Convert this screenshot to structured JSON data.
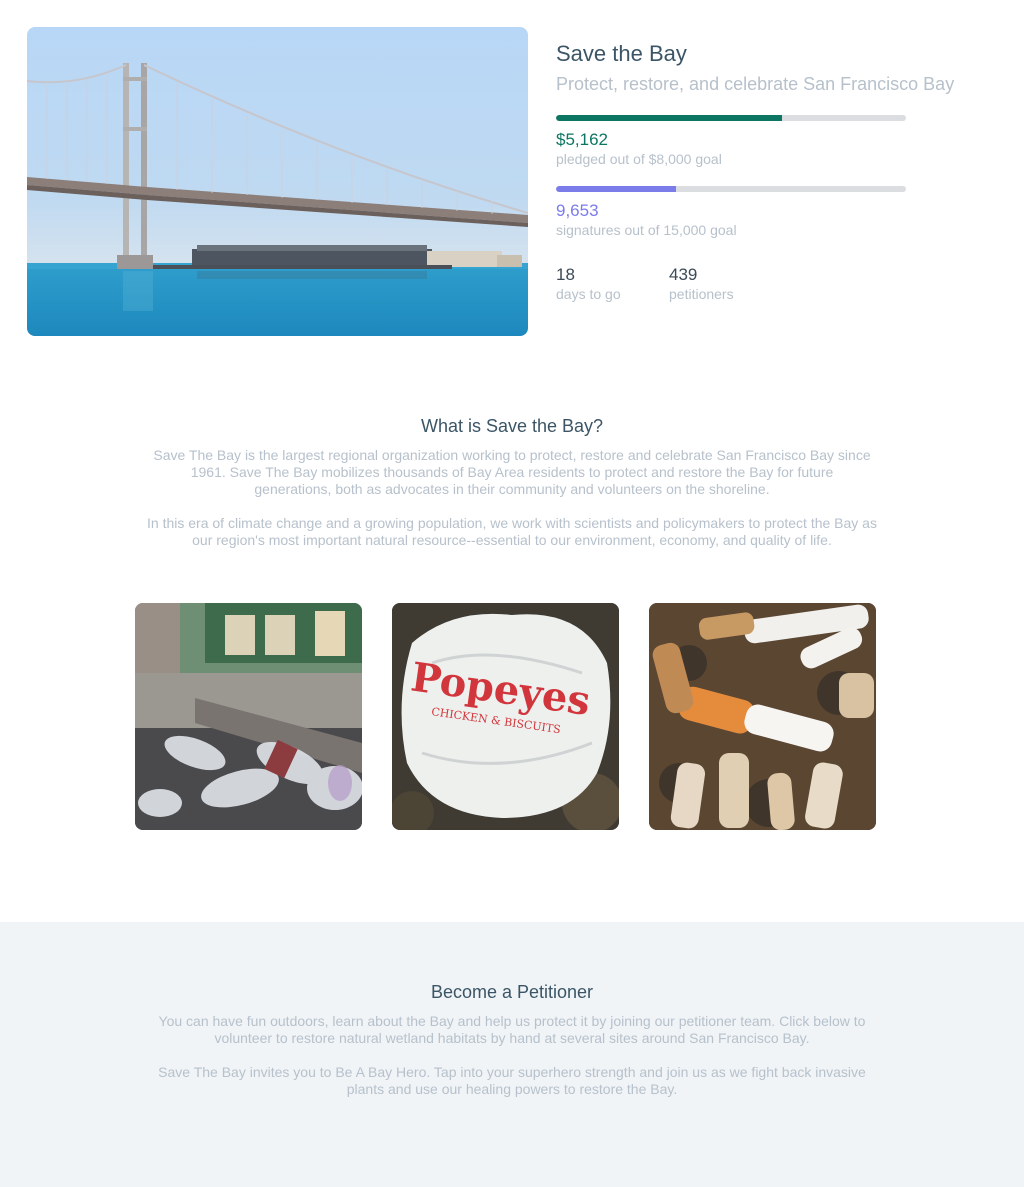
{
  "campaign": {
    "title": "Save the Bay",
    "subtitle": "Protect, restore, and celebrate San Francisco Bay",
    "pledge": {
      "amount": "$5,162",
      "label": "pledged out of $8,000 goal",
      "progress": 0.645
    },
    "signatures": {
      "count": "9,653",
      "label": "signatures out of 15,000 goal",
      "progress": 0.3435
    },
    "stats": [
      {
        "value": "18",
        "label": "days to go"
      },
      {
        "value": "439",
        "label": "petitioners"
      }
    ],
    "colors": {
      "pledge": "#0d7662",
      "signatures": "#7b7bea",
      "track": "#dcdde0"
    }
  },
  "about": {
    "heading": "What is Save the Bay?",
    "paragraphs": [
      "Save The Bay is the largest regional organization working to protect, restore and celebrate San Francisco Bay since 1961. Save The Bay mobilizes thousands of Bay Area residents to protect and restore the Bay for future generations, both as advocates in their community and volunteers on the shoreline.",
      "In this era of climate change and a growing population, we work with scientists and policymakers to protect the Bay as our region's most important natural resource--essential to our environment, economy, and quality of life."
    ]
  },
  "gallery": {
    "images": [
      {
        "name": "bottles-litter-photo"
      },
      {
        "name": "popeyes-bag-photo",
        "bag_text": "Popeyes",
        "bag_subtext": "CHICKEN & BISCUITS"
      },
      {
        "name": "cigarette-butts-photo"
      }
    ]
  },
  "petition": {
    "heading": "Become a Petitioner",
    "paragraphs": [
      "You can have fun outdoors, learn about the Bay and help us protect it by joining our petitioner team. Click below to volunteer to restore natural wetland habitats by hand at several sites around San Francisco Bay.",
      "Save The Bay invites you to Be A Bay Hero. Tap into your superhero strength and join us as we fight back invasive plants and use our healing powers to restore the Bay."
    ]
  }
}
